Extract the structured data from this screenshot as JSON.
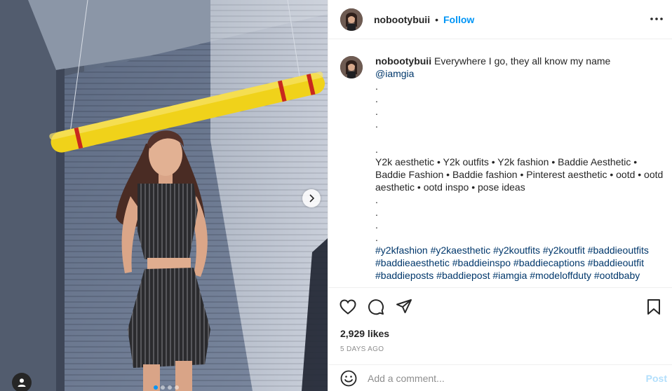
{
  "post": {
    "username": "nobootybuii",
    "separator": "•",
    "follow_label": "Follow",
    "more_icon": "more-horizontal-icon",
    "caption": {
      "username": "nobootybuii",
      "text": "Everywhere I go, they all know my name",
      "mention": "@iamgia",
      "dot_lines_1": [
        ".",
        ".",
        ".",
        "."
      ],
      "dot_line_2": ".",
      "tags_line": "Y2k aesthetic • Y2k outfits • Y2k fashion • Baddie Aesthetic • Baddie Fashion • Baddie fashion • Pinterest aesthetic • ootd • ootd aesthetic • ootd inspo • pose ideas",
      "dot_lines_3": [
        ".",
        ".",
        ".",
        "."
      ],
      "hashtags": "#y2kfashion #y2kaesthetic #y2koutfits #y2koutfit #baddieoutfits #baddieaesthetic #baddieinspo #baddiecaptions #baddieoutfit #baddieposts #baddiepost #iamgia #modeloffduty #ootdbaby"
    },
    "likes": "2,929 likes",
    "timestamp": "5 DAYS AGO",
    "comment_placeholder": "Add a comment...",
    "post_label": "Post"
  },
  "carousel": {
    "slide_count": 4,
    "active_index": 0
  },
  "colors": {
    "accent": "#0095f6",
    "link": "#00376b",
    "muted": "#8e8e8e",
    "post_disabled": "#b2dffc",
    "border": "#efefef"
  }
}
